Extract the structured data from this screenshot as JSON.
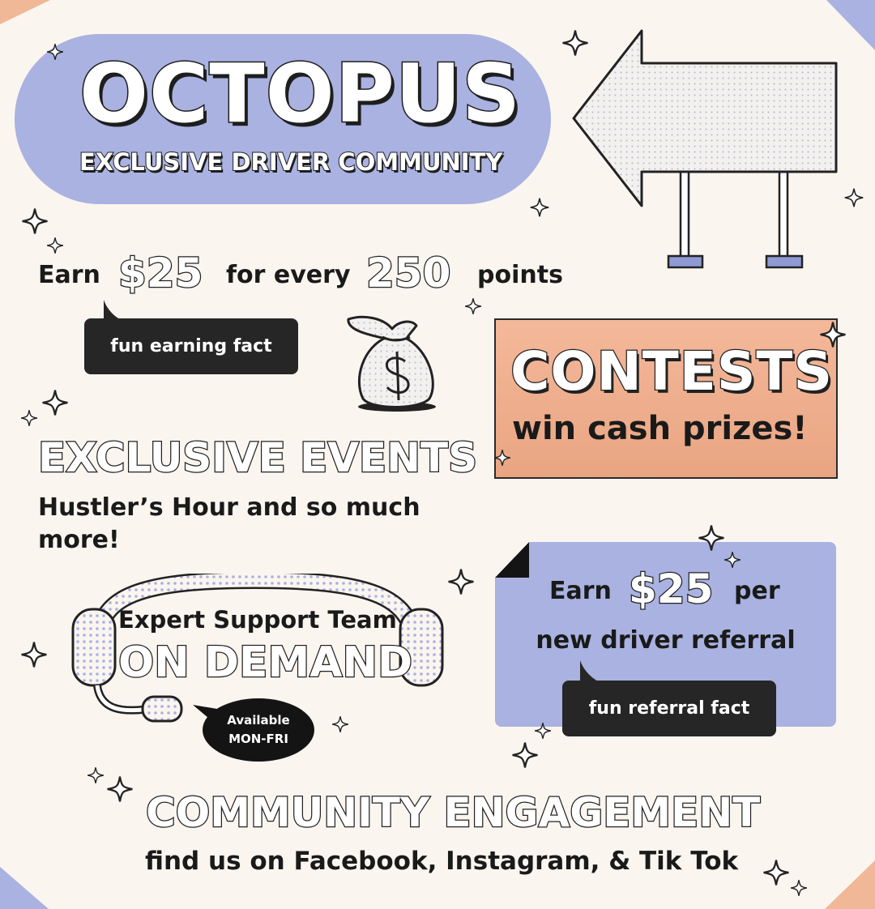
{
  "header": {
    "title": "OCTOPUS",
    "subtitle": "EXCLUSIVE DRIVER COMMUNITY"
  },
  "earn": {
    "prefix": "Earn",
    "amount": "$25",
    "middle": "for every",
    "points": "250",
    "suffix": "points",
    "tag": "fun earning fact"
  },
  "contests": {
    "title": "CONTESTS",
    "subtitle": "win cash prizes!"
  },
  "events": {
    "title": "EXCLUSIVE EVENTS",
    "line1": "Hustler’s Hour and so much",
    "line2": "more!"
  },
  "support": {
    "line1": "Expert Support Team",
    "title": "ON DEMAND",
    "badge_line1": "Available",
    "badge_line2": "MON-FRI"
  },
  "referral": {
    "prefix": "Earn",
    "amount": "$25",
    "suffix": "per",
    "line2": "new driver referral",
    "tag": "fun referral fact"
  },
  "community": {
    "title": "COMMUNITY ENGAGEMENT",
    "line": "find us on Facebook, Instagram, & Tik Tok"
  },
  "colors": {
    "background": "#fbf5ef",
    "lavender": "#a9b2e0",
    "peach": "#efad8a",
    "dark": "#262626"
  },
  "icons": [
    "sparkle-icon",
    "arrow-sign-icon",
    "money-bag-icon",
    "headset-icon"
  ]
}
